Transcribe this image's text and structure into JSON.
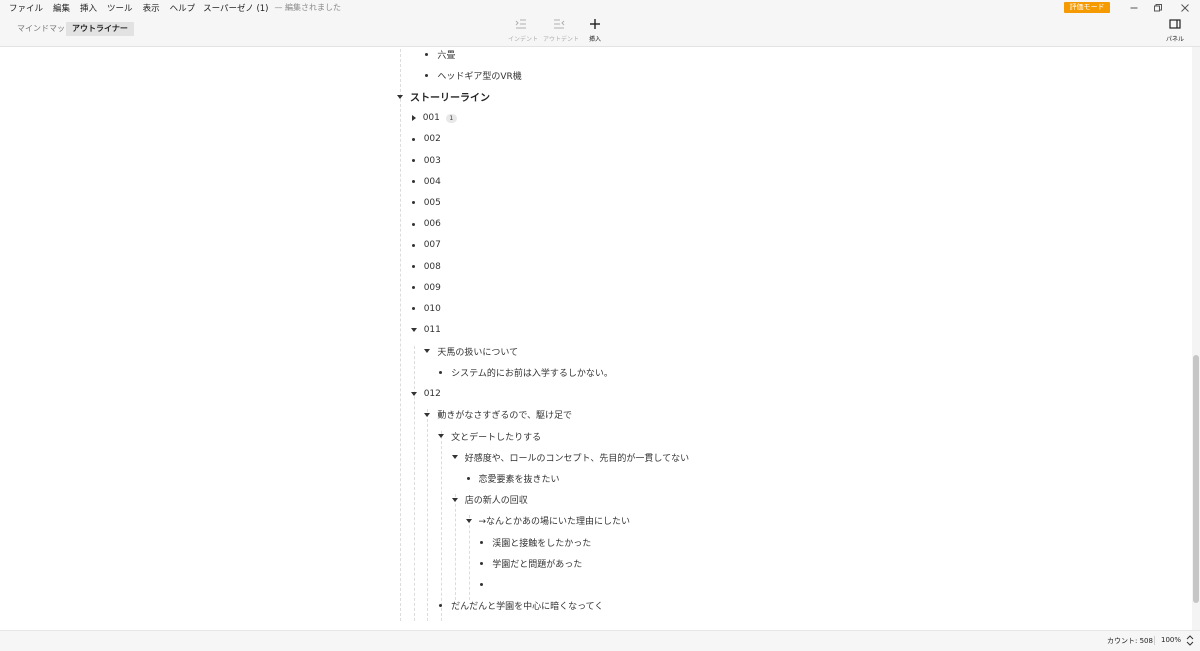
{
  "menu": {
    "items": [
      "ファイル",
      "編集",
      "挿入",
      "ツール",
      "表示",
      "ヘルプ"
    ],
    "doc_title": "スーパーゼノ (1)",
    "doc_status": "— 編集されました",
    "eval_badge": "評価モード"
  },
  "toolbar": {
    "tabs": [
      "マインドマップ",
      "アウトライナー"
    ],
    "active_tab": "アウトライナー",
    "indent_label": "インデント",
    "outdent_label": "アウトデント",
    "insert_label": "挿入",
    "panel_label": "パネル"
  },
  "outline": {
    "items": [
      {
        "text": "六畳",
        "depth": 2,
        "marker": "bullet"
      },
      {
        "text": "ヘッドギア型のVR機",
        "depth": 2,
        "marker": "bullet"
      },
      {
        "text": "ストーリーライン",
        "depth": 0,
        "marker": "expanded",
        "heading": true
      },
      {
        "text": "001",
        "depth": 1,
        "marker": "collapsed",
        "badge": "1"
      },
      {
        "text": "002",
        "depth": 1,
        "marker": "bullet"
      },
      {
        "text": "003",
        "depth": 1,
        "marker": "bullet"
      },
      {
        "text": "004",
        "depth": 1,
        "marker": "bullet"
      },
      {
        "text": "005",
        "depth": 1,
        "marker": "bullet"
      },
      {
        "text": "006",
        "depth": 1,
        "marker": "bullet"
      },
      {
        "text": "007",
        "depth": 1,
        "marker": "bullet"
      },
      {
        "text": "008",
        "depth": 1,
        "marker": "bullet"
      },
      {
        "text": "009",
        "depth": 1,
        "marker": "bullet"
      },
      {
        "text": "010",
        "depth": 1,
        "marker": "bullet"
      },
      {
        "text": "011",
        "depth": 1,
        "marker": "expanded"
      },
      {
        "text": "天馬の扱いについて",
        "depth": 2,
        "marker": "expanded"
      },
      {
        "text": "システム的にお前は入学するしかない。",
        "depth": 3,
        "marker": "bullet"
      },
      {
        "text": "012",
        "depth": 1,
        "marker": "expanded"
      },
      {
        "text": "動きがなさすぎるので、駆け足で",
        "depth": 2,
        "marker": "expanded"
      },
      {
        "text": "文とデートしたりする",
        "depth": 3,
        "marker": "expanded"
      },
      {
        "text": "好感度や、ロールのコンセプト、先目的が一貫してない",
        "depth": 4,
        "marker": "expanded"
      },
      {
        "text": "恋愛要素を抜きたい",
        "depth": 5,
        "marker": "bullet"
      },
      {
        "text": "店の新人の回収",
        "depth": 4,
        "marker": "expanded"
      },
      {
        "text": "→なんとかあの場にいた理由にしたい",
        "depth": 5,
        "marker": "expanded"
      },
      {
        "text": "渓園と接触をしたかった",
        "depth": 6,
        "marker": "bullet"
      },
      {
        "text": "学園だと問題があった",
        "depth": 6,
        "marker": "bullet"
      },
      {
        "text": "",
        "depth": 6,
        "marker": "bullet"
      },
      {
        "text": "だんだんと学園を中心に暗くなってく",
        "depth": 3,
        "marker": "bullet"
      }
    ]
  },
  "status": {
    "count": "カウント: 508",
    "zoom": "100%"
  }
}
